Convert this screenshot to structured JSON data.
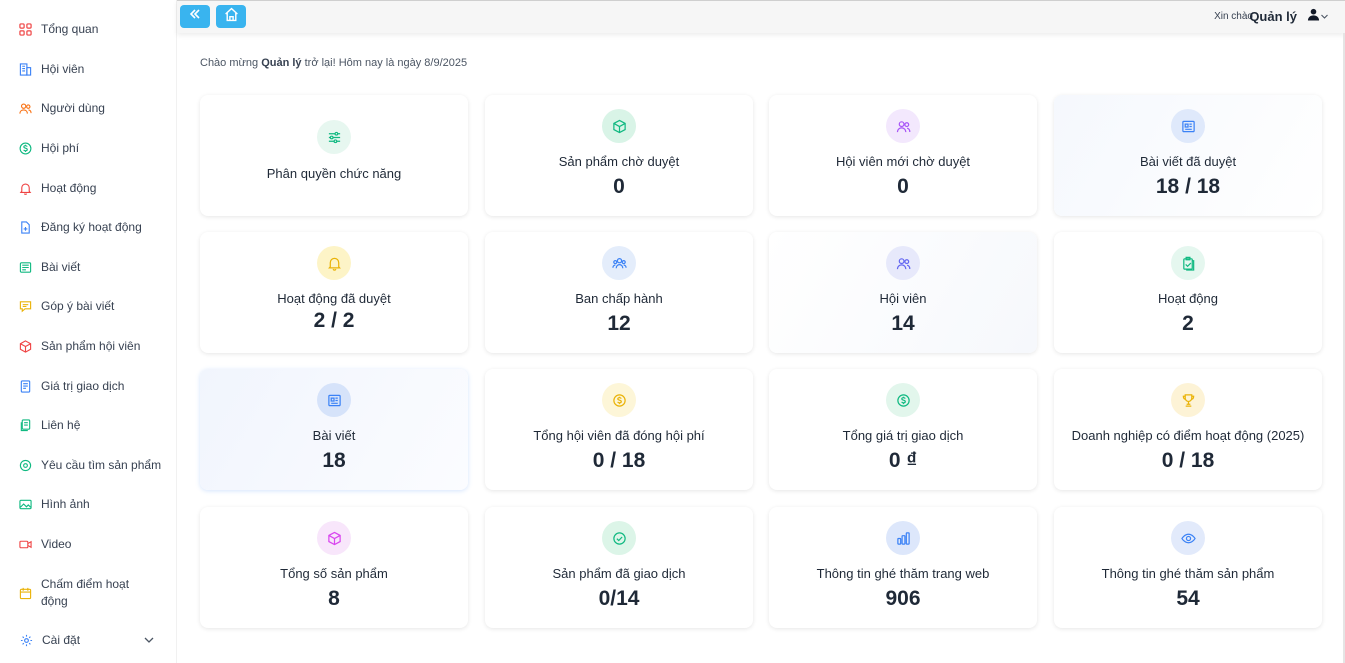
{
  "sidebar": {
    "items": [
      {
        "label": "Tổng quan",
        "icon": "grid-icon"
      },
      {
        "label": "Hội viên",
        "icon": "building-icon"
      },
      {
        "label": "Người dùng",
        "icon": "users-icon"
      },
      {
        "label": "Hội phí",
        "icon": "dollar-circle-icon"
      },
      {
        "label": "Hoạt động",
        "icon": "bell-icon"
      },
      {
        "label": "Đăng ký hoạt động",
        "icon": "file-add-icon"
      },
      {
        "label": "Bài viết",
        "icon": "article-icon"
      },
      {
        "label": "Góp ý bài viết",
        "icon": "comment-icon"
      },
      {
        "label": "Sản phẩm hội viên",
        "icon": "box-icon"
      },
      {
        "label": "Giá trị giao dịch",
        "icon": "receipt-icon"
      },
      {
        "label": "Liên hệ",
        "icon": "contact-icon"
      },
      {
        "label": "Yêu cầu tìm sản phẩm",
        "icon": "target-icon"
      },
      {
        "label": "Hình ảnh",
        "icon": "image-icon"
      },
      {
        "label": "Video",
        "icon": "video-icon"
      },
      {
        "label": "Chấm điểm hoạt động",
        "icon": "calendar-icon"
      },
      {
        "label": "Cài đặt",
        "icon": "gear-icon"
      }
    ]
  },
  "header": {
    "greeting": "Xin chào",
    "username": "Quản lý"
  },
  "welcome": {
    "prefix": "Chào mừng",
    "name": "Quản lý",
    "suffix": "trở lại! Hôm nay là ngày 8/9/2025"
  },
  "cards": [
    {
      "title": "Phân quyền chức năng",
      "value": "",
      "icon": "sliders-icon",
      "color": "#10b981",
      "bg": "#e7f7f0"
    },
    {
      "title": "Sản phẩm chờ duyệt",
      "value": "0",
      "icon": "box-icon",
      "color": "#10b981",
      "bg": "#d9f4e7"
    },
    {
      "title": "Hội viên mới chờ duyệt",
      "value": "0",
      "icon": "users-icon",
      "color": "#a855f7",
      "bg": "#f3e8fd"
    },
    {
      "title": "Bài viết đã duyệt",
      "value": "18 / 18",
      "icon": "article-icon",
      "color": "#3b82f6",
      "bg": "#dfe9fb"
    },
    {
      "title": "Hoạt động đã duyệt",
      "value": "2 / 2",
      "icon": "bell-icon",
      "color": "#eab308",
      "bg": "#fdf4c7"
    },
    {
      "title": "Ban chấp hành",
      "value": "12",
      "icon": "group-icon",
      "color": "#3b82f6",
      "bg": "#e4edfb"
    },
    {
      "title": "Hội viên",
      "value": "14",
      "icon": "users-icon",
      "color": "#6366f1",
      "bg": "#e7e9fb"
    },
    {
      "title": "Hoạt động",
      "value": "2",
      "icon": "clipboard-check-icon",
      "color": "#10b981",
      "bg": "#e5f7ef"
    },
    {
      "title": "Bài viết",
      "value": "18",
      "icon": "article-icon",
      "color": "#3b82f6",
      "bg": "#d6e3fa"
    },
    {
      "title": "Tổng hội viên đã đóng hội phí",
      "value": "0 / 18",
      "icon": "coin-icon",
      "color": "#eab308",
      "bg": "#fdf6d8"
    },
    {
      "title": "Tổng giá trị giao dịch",
      "value": "0 ₫",
      "icon": "dollar-circle-icon",
      "color": "#10b981",
      "bg": "#e2f6ec"
    },
    {
      "title": "Doanh nghiệp có điểm hoạt động (2025)",
      "value": "0 / 18",
      "icon": "trophy-icon",
      "color": "#eab308",
      "bg": "#fdf3d6"
    },
    {
      "title": "Tổng số sản phẩm",
      "value": "8",
      "icon": "box-icon",
      "color": "#d946ef",
      "bg": "#f8e6fb"
    },
    {
      "title": "Sản phẩm đã giao dịch",
      "value": "0/14",
      "icon": "check-circle-icon",
      "color": "#10b981",
      "bg": "#dcf5e8"
    },
    {
      "title": "Thông tin ghé thăm trang web",
      "value": "906",
      "icon": "bar-chart-icon",
      "color": "#3b82f6",
      "bg": "#dde7fb"
    },
    {
      "title": "Thông tin ghé thăm sản phẩm",
      "value": "54",
      "icon": "eye-icon",
      "color": "#3b82f6",
      "bg": "#e2eafb"
    }
  ]
}
